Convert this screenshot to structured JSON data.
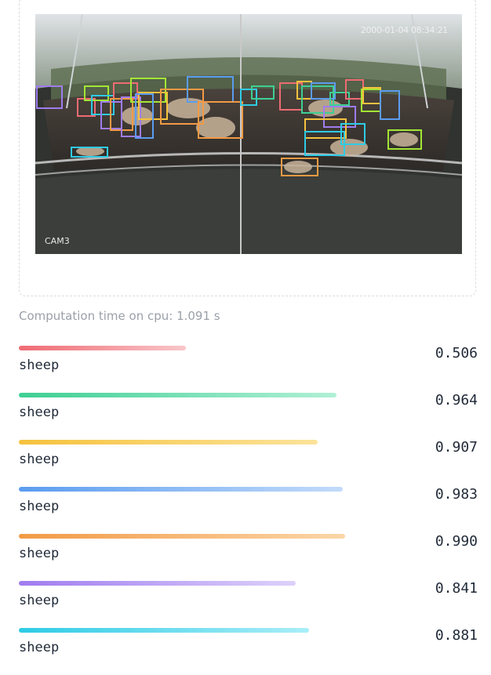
{
  "camera": {
    "cam_label": "CAM3",
    "timestamp": "2000-01-04 08:34:21"
  },
  "computation_text": "Computation time on cpu: 1.091 s",
  "results": [
    {
      "label": "sheep",
      "score": "0.506",
      "value": 0.506,
      "color_start": "#ef6b73",
      "color_end": "#f9c6c9"
    },
    {
      "label": "sheep",
      "score": "0.964",
      "value": 0.964,
      "color_start": "#3ecf94",
      "color_end": "#b1f0d6"
    },
    {
      "label": "sheep",
      "score": "0.907",
      "value": 0.907,
      "color_start": "#f6c23e",
      "color_end": "#fbe39a"
    },
    {
      "label": "sheep",
      "score": "0.983",
      "value": 0.983,
      "color_start": "#5b9cf0",
      "color_end": "#c2dbfa"
    },
    {
      "label": "sheep",
      "score": "0.990",
      "value": 0.99,
      "color_start": "#f29a45",
      "color_end": "#fbd6a8"
    },
    {
      "label": "sheep",
      "score": "0.841",
      "value": 0.841,
      "color_start": "#9f7cef",
      "color_end": "#ddd1fb"
    },
    {
      "label": "sheep",
      "score": "0.881",
      "value": 0.881,
      "color_start": "#2fcbe5",
      "color_end": "#a9eef8"
    }
  ]
}
